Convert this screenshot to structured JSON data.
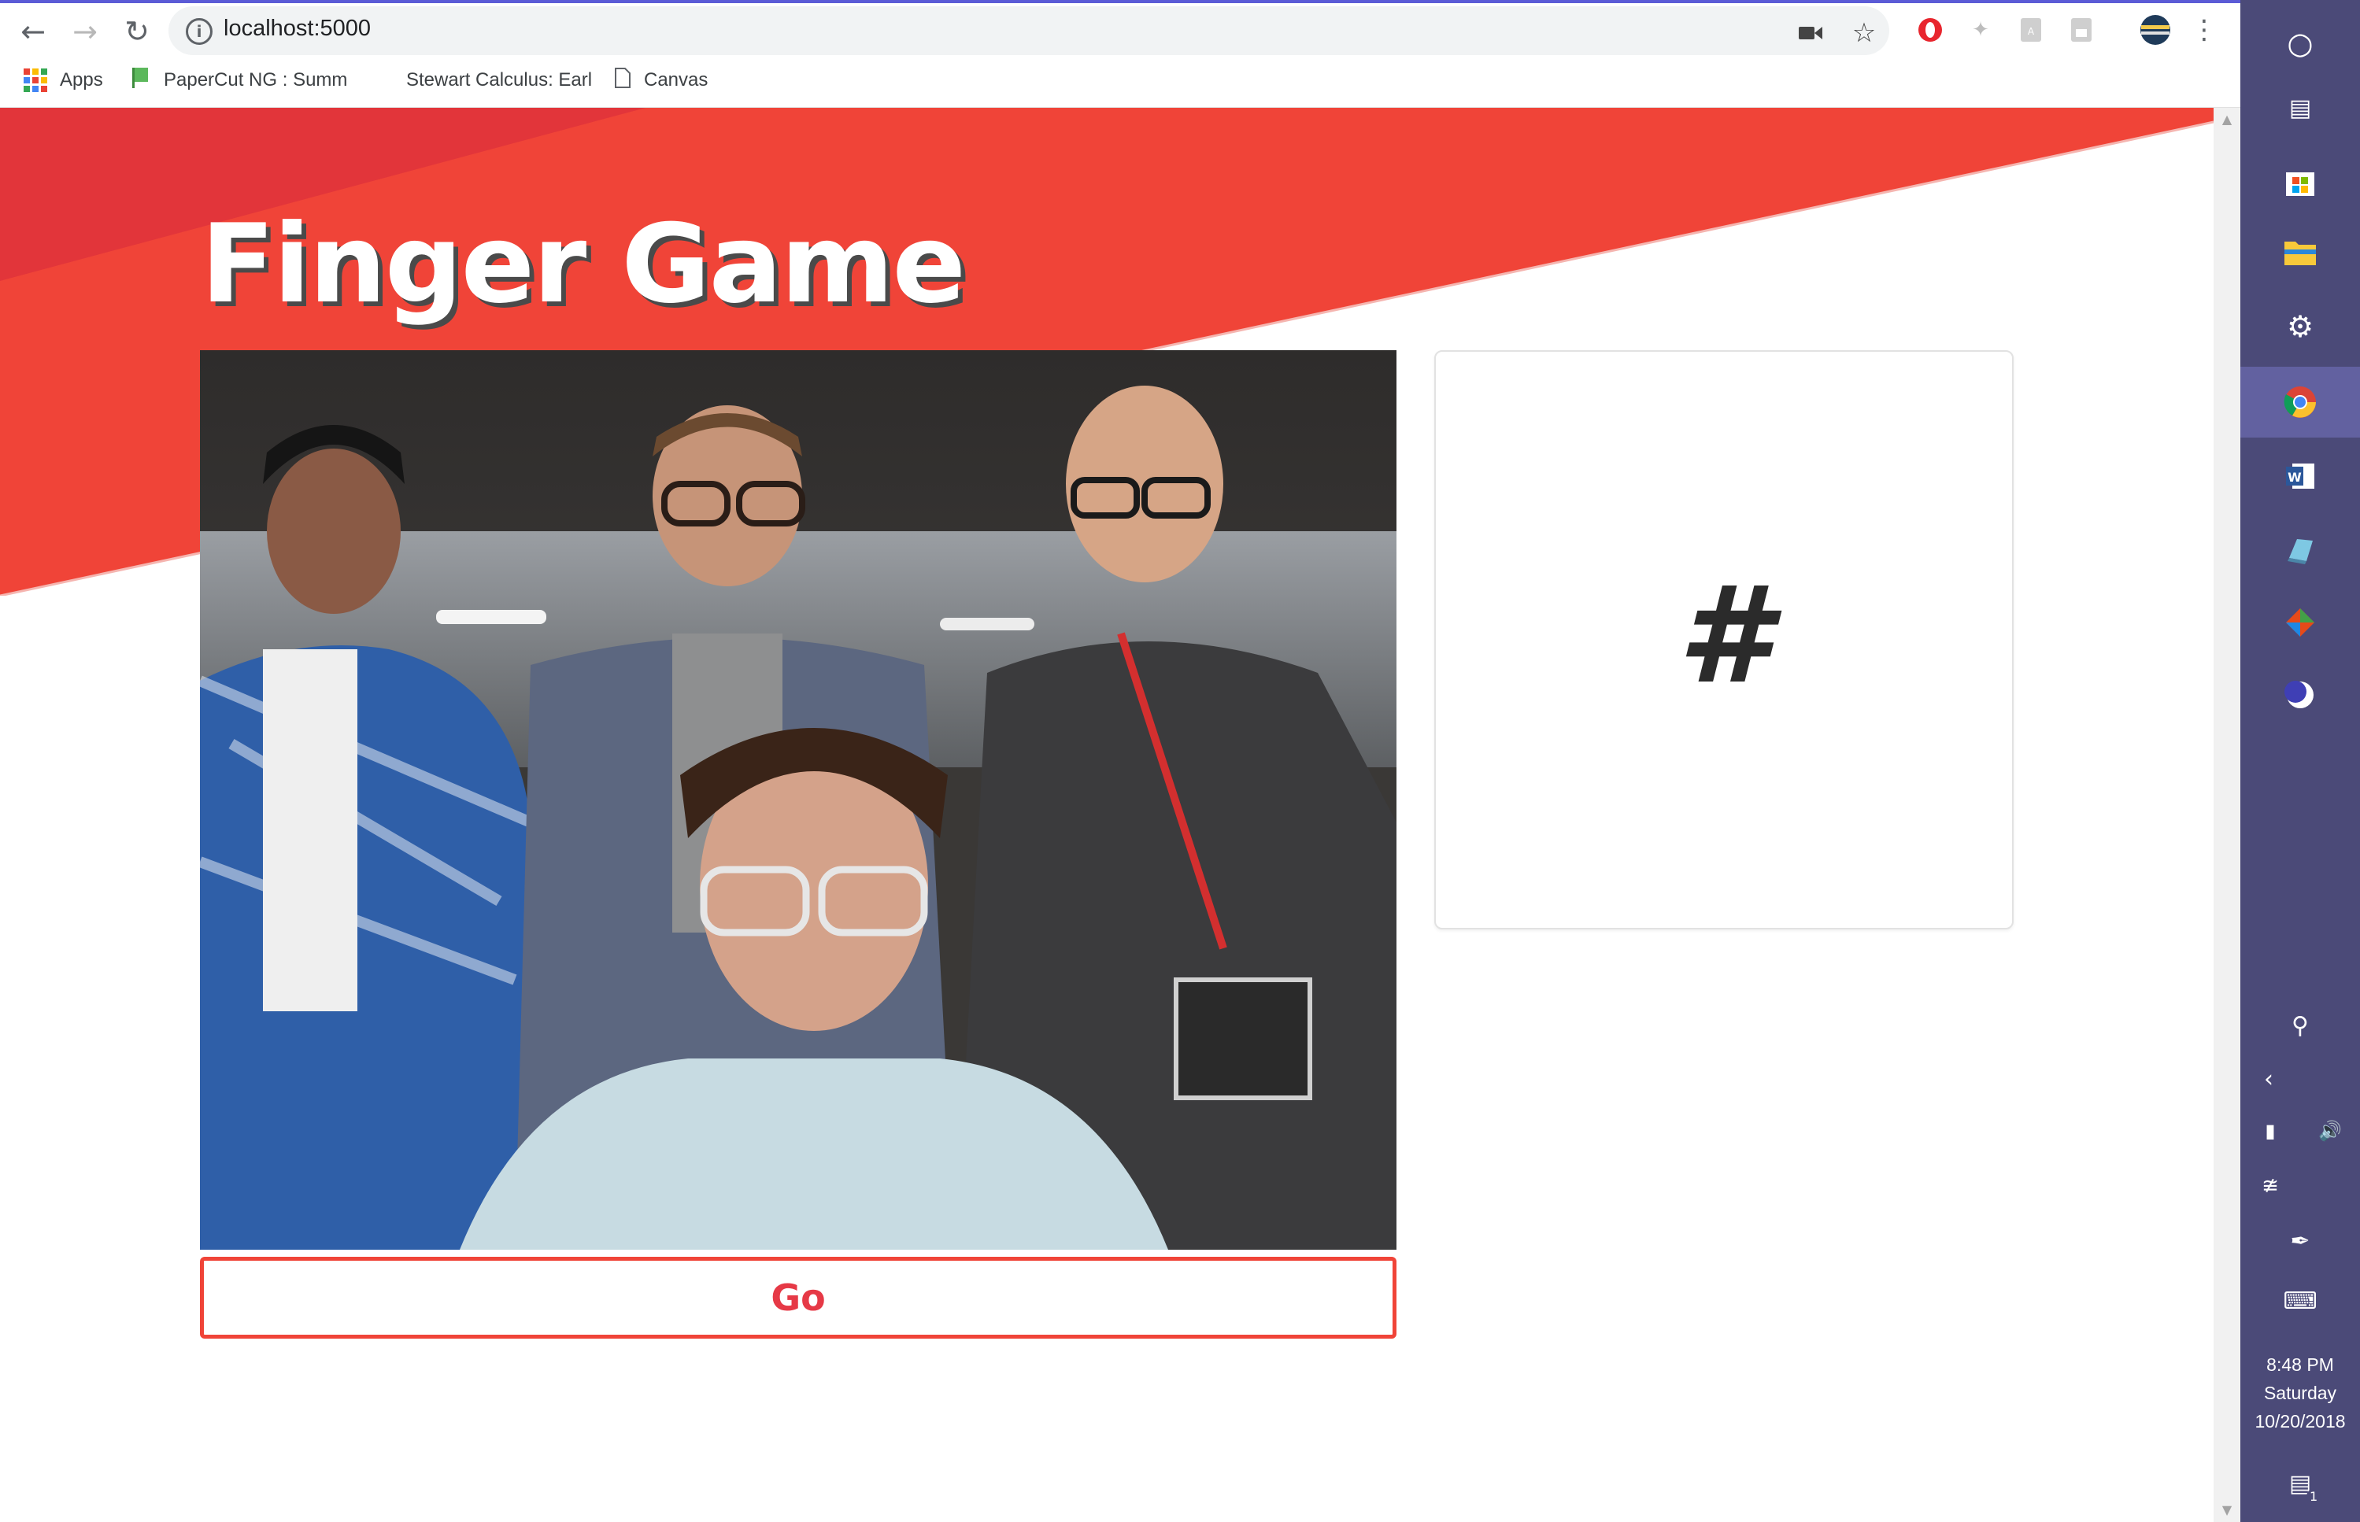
{
  "browser": {
    "url": "localhost:5000",
    "bookmarks": [
      "Apps",
      "PaperCut NG : Summ",
      "Stewart Calculus: Earl",
      "Canvas"
    ]
  },
  "page": {
    "title": "Finger Game",
    "go_label": "Go",
    "result": "#"
  },
  "taskbar": {
    "time": "8:48 PM",
    "day": "Saturday",
    "date": "10/20/2018",
    "notification_count": "1"
  },
  "colors": {
    "banner_red": "#f04438",
    "banner_dark": "#e2353a",
    "taskbar": "#4b4a78",
    "accent": "#e63946"
  }
}
